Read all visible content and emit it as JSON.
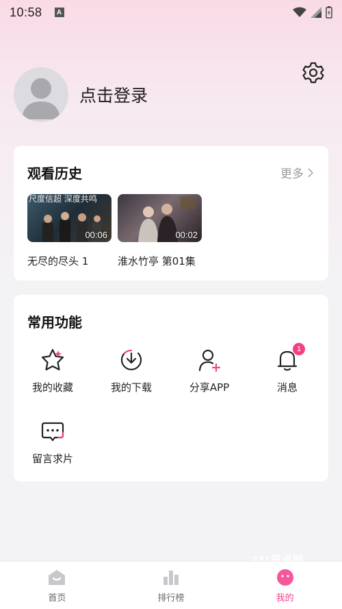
{
  "status_bar": {
    "time": "10:58",
    "notif_icon": "A"
  },
  "profile": {
    "login_label": "点击登录"
  },
  "history": {
    "title": "观看历史",
    "more_label": "更多",
    "items": [
      {
        "title": "无尽的尽头 1",
        "duration": "00:06",
        "caption": "尺度信超 深度共鸣"
      },
      {
        "title": "淮水竹亭 第01集",
        "duration": "00:02"
      }
    ]
  },
  "functions": {
    "title": "常用功能",
    "items": [
      {
        "label": "我的收藏",
        "icon": "star-icon"
      },
      {
        "label": "我的下载",
        "icon": "download-icon"
      },
      {
        "label": "分享APP",
        "icon": "share-user-icon"
      },
      {
        "label": "消息",
        "icon": "bell-icon",
        "badge": "1"
      },
      {
        "label": "留言求片",
        "icon": "message-icon"
      }
    ]
  },
  "tabbar": {
    "tabs": [
      {
        "label": "首页",
        "icon": "home-icon"
      },
      {
        "label": "排行榜",
        "icon": "ranking-icon"
      },
      {
        "label": "我的",
        "icon": "mine-icon",
        "active": true
      }
    ]
  },
  "colors": {
    "accent": "#f0428e",
    "badge": "#f43f83",
    "background": "#f3f3f6"
  },
  "watermark": "221安卓网"
}
